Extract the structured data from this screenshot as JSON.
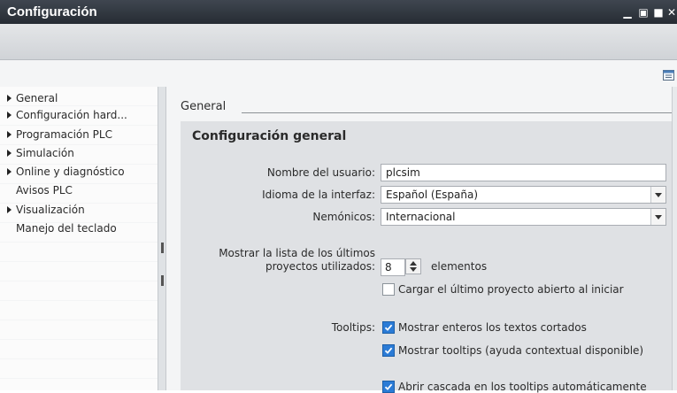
{
  "window": {
    "title": "Configuración",
    "controls": {
      "minimize": "▁",
      "restore": "▣",
      "maximize": "■",
      "close": "✕"
    }
  },
  "sidebar": {
    "items": [
      {
        "label": "General",
        "has_arrow": true
      },
      {
        "label": "Configuración hard...",
        "has_arrow": true
      },
      {
        "label": "Programación PLC",
        "has_arrow": true
      },
      {
        "label": "Simulación",
        "has_arrow": true
      },
      {
        "label": "Online y diagnóstico",
        "has_arrow": true
      },
      {
        "label": "Avisos PLC",
        "has_arrow": false
      },
      {
        "label": "Visualización",
        "has_arrow": true
      },
      {
        "label": "Manejo del teclado",
        "has_arrow": false
      }
    ]
  },
  "content": {
    "section_title": "General",
    "panel_title": "Configuración general",
    "username": {
      "label": "Nombre del usuario:",
      "value": "plcsim"
    },
    "language": {
      "label": "Idioma de la interfaz:",
      "value": "Español (España)"
    },
    "mnemonics": {
      "label": "Nemónicos:",
      "value": "Internacional"
    },
    "recent": {
      "label_line1": "Mostrar la lista de los últimos",
      "label_line2": "proyectos utilizados:",
      "value": "8",
      "unit": "elementos"
    },
    "load_last": {
      "label": "Cargar el último proyecto abierto al iniciar",
      "checked": false
    },
    "tooltips": {
      "label": "Tooltips:",
      "show_full": {
        "label": "Mostrar enteros los textos cortados",
        "checked": true
      },
      "show_tooltips": {
        "label": "Mostrar tooltips (ayuda contextual disponible)",
        "checked": true
      },
      "cascade": {
        "label": "Abrir cascada en los tooltips automáticamente",
        "checked": true
      }
    }
  },
  "colors": {
    "titlebar": "#2f353d",
    "checkbox_checked": "#2b7bd6",
    "panel": "#dfe1e4",
    "content_bg": "#f4f5f6"
  }
}
